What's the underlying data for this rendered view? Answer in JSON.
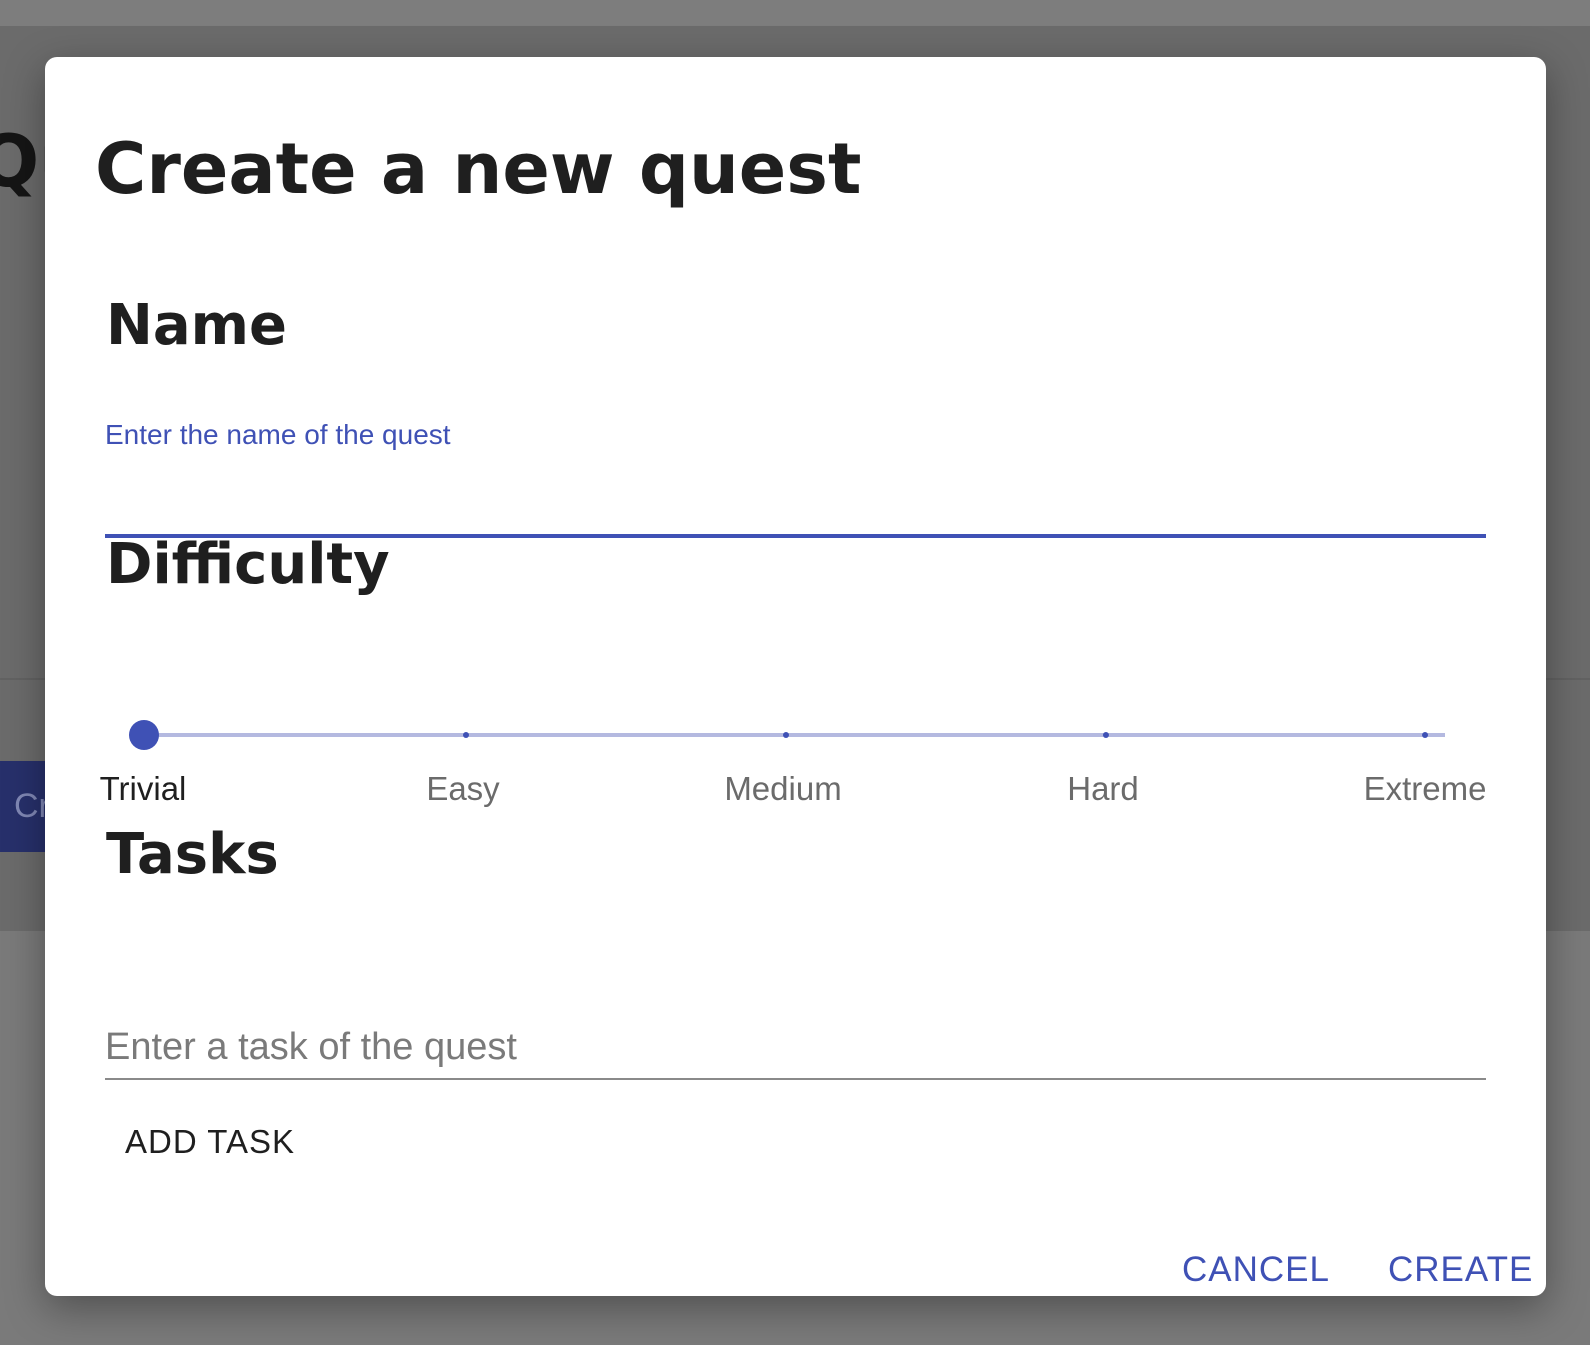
{
  "background": {
    "page_heading": "Qu",
    "action_button_label": "Cr"
  },
  "dialog": {
    "title": "Create a new quest",
    "name": {
      "heading": "Name",
      "label": "Enter the name of the quest",
      "value": ""
    },
    "difficulty": {
      "heading": "Difficulty",
      "options": [
        "Trivial",
        "Easy",
        "Medium",
        "Hard",
        "Extreme"
      ],
      "selected": "Trivial",
      "selected_index": 0
    },
    "tasks": {
      "heading": "Tasks",
      "placeholder": "Enter a task of the quest",
      "add_label": "ADD TASK"
    },
    "actions": {
      "cancel_label": "CANCEL",
      "create_label": "CREATE"
    }
  },
  "colors": {
    "accent": "#3f51b5",
    "rail": "#b4b9e0",
    "overlay": "#6e6e6e"
  }
}
